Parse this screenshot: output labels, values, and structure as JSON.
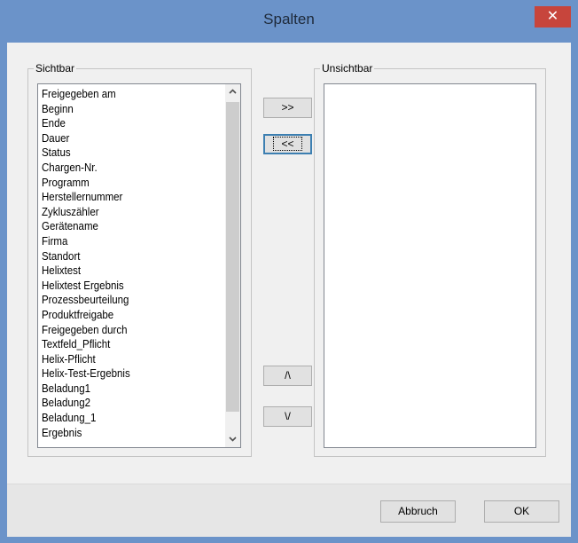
{
  "window": {
    "title": "Spalten",
    "close_glyph": "✕"
  },
  "visible_group": {
    "legend": "Sichtbar",
    "items": [
      "Freigegeben am",
      "Beginn",
      "Ende",
      "Dauer",
      "Status",
      "Chargen-Nr.",
      "Programm",
      "Herstellernummer",
      "Zykluszähler",
      "Gerätename",
      "Firma",
      "Standort",
      "Helixtest",
      "Helixtest Ergebnis",
      "Prozessbeurteilung",
      "Produktfreigabe",
      "Freigegeben durch",
      "Textfeld_Pflicht",
      "Helix-Pflicht",
      "Helix-Test-Ergebnis",
      "Beladung1",
      "Beladung2",
      "Beladung_1",
      "Ergebnis"
    ]
  },
  "hidden_group": {
    "legend": "Unsichtbar",
    "items": []
  },
  "buttons": {
    "move_right": ">>",
    "move_left": "<<",
    "move_up": "/\\",
    "move_down": "\\/",
    "cancel": "Abbruch",
    "ok": "OK"
  },
  "scroll_icons": {
    "up": "chevron-up-icon",
    "down": "chevron-down-icon"
  }
}
